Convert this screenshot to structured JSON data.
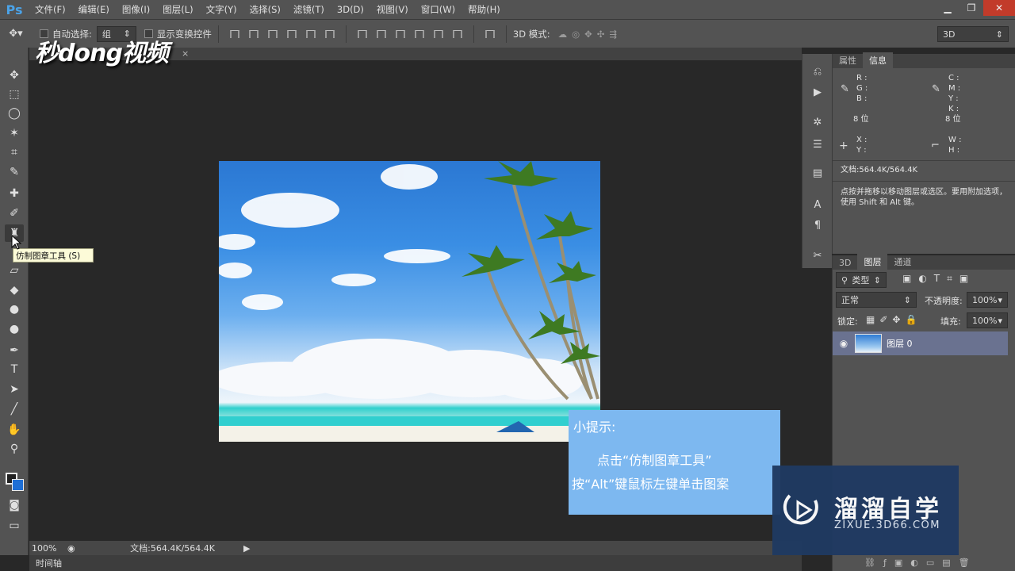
{
  "app": {
    "logo": "Ps",
    "menus": [
      "文件(F)",
      "编辑(E)",
      "图像(I)",
      "图层(L)",
      "文字(Y)",
      "选择(S)",
      "滤镜(T)",
      "3D(D)",
      "视图(V)",
      "窗口(W)",
      "帮助(H)"
    ]
  },
  "options": {
    "auto_select_label": "自动选择:",
    "auto_select_value": "组",
    "show_transform_label": "显示变换控件",
    "mode_3d_label": "3D 模式:",
    "workspace_value": "3D"
  },
  "tooltip": {
    "text": "仿制图章工具 (S)"
  },
  "status": {
    "zoom": "100%",
    "doc_size": "文档:564.4K/564.4K",
    "timeline_label": "时间轴"
  },
  "info_panel": {
    "tabs": [
      "属性",
      "信息"
    ],
    "active_tab": "信息",
    "rgb_labels": "R :\nG :\nB :",
    "cmyk_labels": "C :\nM :\nY :\nK :",
    "bit_left": "8 位",
    "bit_right": "8 位",
    "xy_labels": "X :\nY :",
    "wh_labels": "W :\nH :",
    "doc_size": "文档:564.4K/564.4K",
    "hint": "点按并拖移以移动图层或选区。要用附加选项，使用 Shift 和 Alt 键。"
  },
  "layers_panel": {
    "tabs": [
      "3D",
      "图层",
      "通道"
    ],
    "active_tab": "图层",
    "filter_label": "类型",
    "blend_mode": "正常",
    "opacity_label": "不透明度:",
    "opacity_value": "100%",
    "lock_label": "锁定:",
    "fill_label": "填充:",
    "fill_value": "100%",
    "layer_name": "图层 0"
  },
  "hint_box": {
    "title": "小提示:",
    "line1": "点击“仿制图章工具”",
    "line2": "按“Alt”键鼠标左键单击图案"
  },
  "watermarks": {
    "top_left": "秒dong视频",
    "brand_name": "溜溜自学",
    "brand_url": "ZIXUE.3D66.COM"
  },
  "colors": {
    "ui_panel": "#535353",
    "canvas_bg": "#282828",
    "hint_bg": "#7db8f0",
    "brand_bg": "#1f3a62",
    "selected_layer": "#6a7290"
  }
}
